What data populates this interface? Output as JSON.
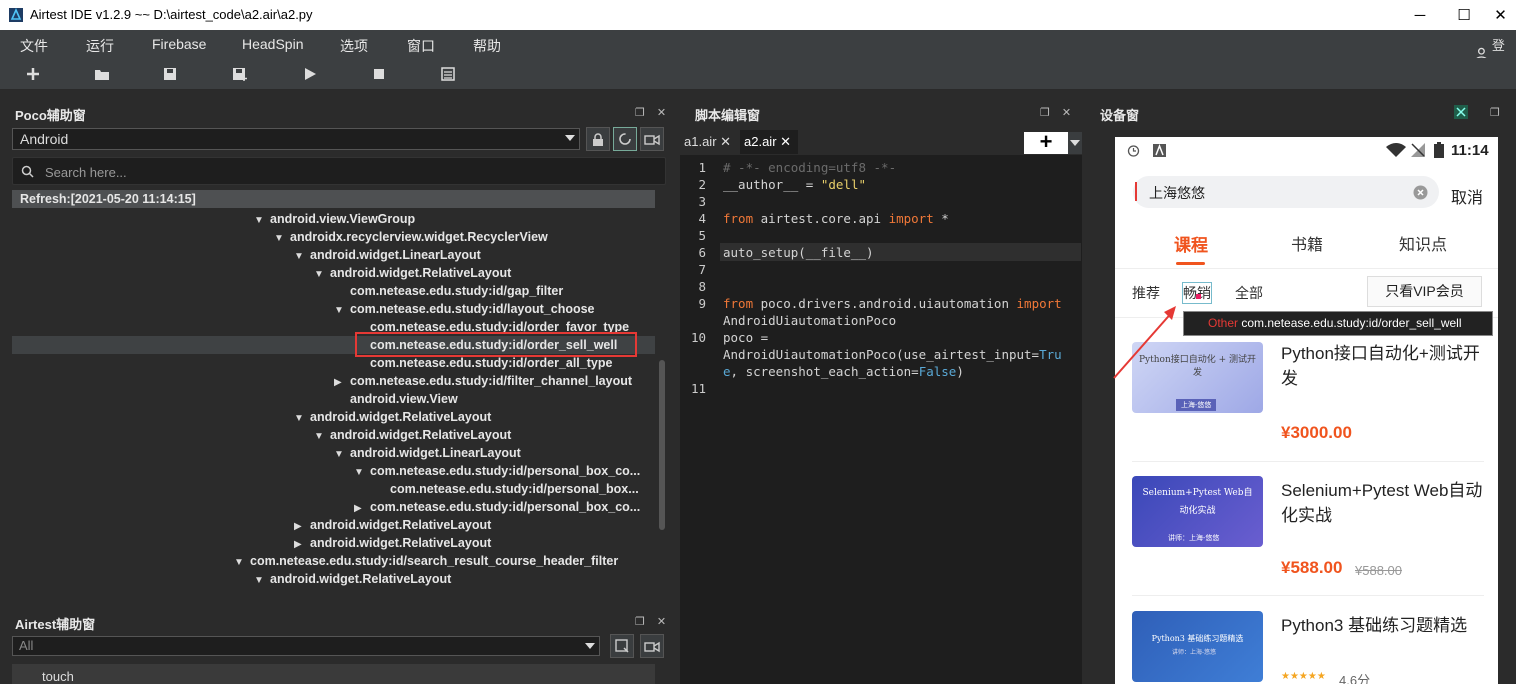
{
  "titlebar": {
    "title": "Airtest IDE v1.2.9 ~~ D:\\airtest_code\\a2.air\\a2.py",
    "minimize": "─",
    "maximize": "☐",
    "close": "✕"
  },
  "menu": [
    "文件",
    "运行",
    "Firebase",
    "HeadSpin",
    "选项",
    "窗口",
    "帮助"
  ],
  "login": "登录",
  "toolbar": [
    "add-icon",
    "open-folder-icon",
    "save-icon",
    "save-as-icon",
    "run-icon",
    "stop-icon",
    "log-icon"
  ],
  "poco": {
    "title": "Poco辅助窗",
    "mode": "Android",
    "search_placeholder": "Search here...",
    "refresh": "Refresh:[2021-05-20 11:14:15]",
    "tree": [
      {
        "text": "android.view.ViewGroup",
        "depth": 0,
        "arrow": "▼"
      },
      {
        "text": "androidx.recyclerview.widget.RecyclerView",
        "depth": 1,
        "arrow": "▼"
      },
      {
        "text": "android.widget.LinearLayout",
        "depth": 2,
        "arrow": "▼"
      },
      {
        "text": "android.widget.RelativeLayout",
        "depth": 3,
        "arrow": "▼"
      },
      {
        "text": "com.netease.edu.study:id/gap_filter",
        "depth": 4,
        "arrow": ""
      },
      {
        "text": "com.netease.edu.study:id/layout_choose",
        "depth": 4,
        "arrow": "▼"
      },
      {
        "text": "com.netease.edu.study:id/order_favor_type",
        "depth": 5,
        "arrow": ""
      },
      {
        "text": "com.netease.edu.study:id/order_sell_well",
        "depth": 5,
        "arrow": "",
        "selected": true
      },
      {
        "text": "com.netease.edu.study:id/order_all_type",
        "depth": 5,
        "arrow": ""
      },
      {
        "text": "com.netease.edu.study:id/filter_channel_layout",
        "depth": 4,
        "arrow": "▶"
      },
      {
        "text": "android.view.View",
        "depth": 4,
        "arrow": ""
      },
      {
        "text": "android.widget.RelativeLayout",
        "depth": 2,
        "arrow": "▼"
      },
      {
        "text": "android.widget.RelativeLayout",
        "depth": 3,
        "arrow": "▼"
      },
      {
        "text": "android.widget.LinearLayout",
        "depth": 4,
        "arrow": "▼"
      },
      {
        "text": "com.netease.edu.study:id/personal_box_co...",
        "depth": 5,
        "arrow": "▼"
      },
      {
        "text": "com.netease.edu.study:id/personal_box...",
        "depth": 6,
        "arrow": ""
      },
      {
        "text": "com.netease.edu.study:id/personal_box_co...",
        "depth": 5,
        "arrow": "▶"
      },
      {
        "text": "android.widget.RelativeLayout",
        "depth": 2,
        "arrow": "▶"
      },
      {
        "text": "android.widget.RelativeLayout",
        "depth": 2,
        "arrow": "▶"
      },
      {
        "text": "com.netease.edu.study:id/search_result_course_header_filter",
        "depth": -1,
        "arrow": "▼"
      },
      {
        "text": "android.widget.RelativeLayout",
        "depth": 0,
        "arrow": "▼"
      }
    ]
  },
  "airtest": {
    "title": "Airtest辅助窗",
    "filter": "All",
    "item": "touch"
  },
  "editor": {
    "title": "脚本编辑窗",
    "tabs": [
      {
        "label": "a1.air",
        "close": "✕"
      },
      {
        "label": "a2.air",
        "close": "✕",
        "active": true
      }
    ],
    "add": "+",
    "line_numbers": [
      "1",
      "2",
      "3",
      "4",
      "5",
      "6",
      "7",
      "8",
      "9",
      "10",
      "11"
    ],
    "lines": {
      "l1": "# -*- encoding=utf8 -*-",
      "l2a": "__author__ = ",
      "l2b": "\"dell\"",
      "l4a": "from",
      "l4b": " airtest.core.api ",
      "l4c": "import",
      "l4d": " *",
      "l6": "auto_setup(__file__)",
      "l9a": "from",
      "l9b": " poco.drivers.android.uiautomation ",
      "l9c": "import",
      "l9d": "AndroidUiautomationPoco",
      "l10a": "poco =",
      "l10b": "AndroidUiautomationPoco(use_airtest_input=",
      "l10c": "Tru",
      "l10d": "e",
      "l10e": ", screenshot_each_action=",
      "l10f": "False",
      "l10g": ")"
    }
  },
  "device": {
    "title": "设备窗",
    "time": "11:14",
    "search_value": "上海悠悠",
    "cancel": "取消",
    "tabs": [
      "课程",
      "书籍",
      "知识点"
    ],
    "filters": [
      "推荐",
      "畅销",
      "全部"
    ],
    "vip": "只看VIP会员",
    "tooltip_type": "Other",
    "tooltip_name": "com.netease.edu.study:id/order_sell_well",
    "courses": [
      {
        "title": "Python接口自动化+测试开发",
        "price": "¥3000.00",
        "old_price": "",
        "img_text": "Python接口自动化 + 测试开发",
        "img_sub": "上海-悠悠"
      },
      {
        "title": "Selenium+Pytest Web自动化实战",
        "price": "¥588.00",
        "old_price": "¥588.00",
        "img_text": "Selenium+Pytest Web自动化实战",
        "img_sub": "讲师：上海-悠悠"
      },
      {
        "title": "Python3 基础练习题精选",
        "price": "",
        "old_price": "",
        "rating": "4.6分",
        "img_text": "Python3 基础练习题精选",
        "img_sub": "讲师：上海-悠悠"
      }
    ],
    "accent": "#f0541e"
  }
}
